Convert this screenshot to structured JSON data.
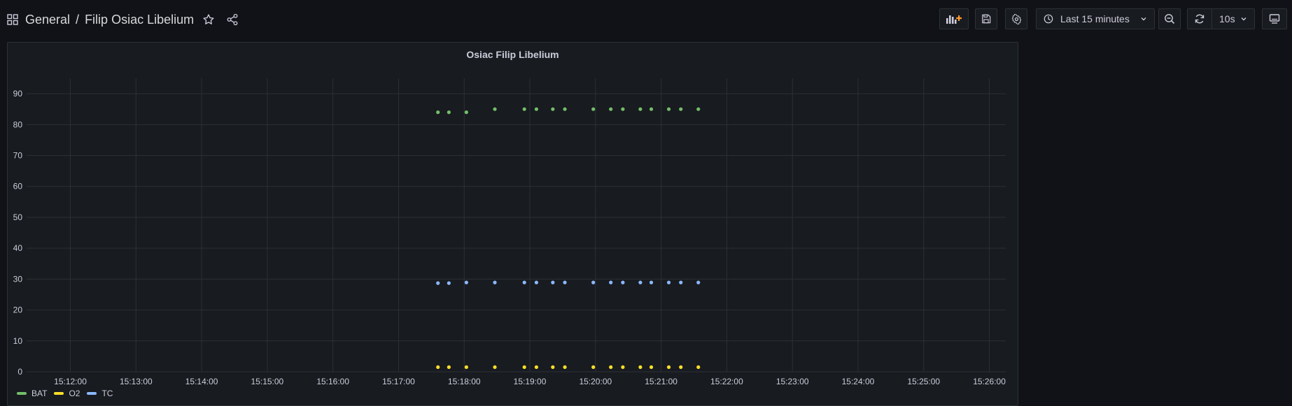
{
  "header": {
    "folder": "General",
    "separator": "/",
    "dashboard_title": "Filip Osiac Libelium"
  },
  "toolbar": {
    "time_range": "Last 15 minutes",
    "refresh_interval": "10s"
  },
  "colors": {
    "BAT": "#73bf69",
    "O2": "#fade2a",
    "TC": "#8ab8ff",
    "accent": "#ff9830"
  },
  "panel": {
    "title": "Osiac Filip Libelium"
  },
  "chart_data": {
    "type": "scatter",
    "title": "Osiac Filip Libelium",
    "xlabel": "",
    "ylabel": "",
    "ylim": [
      0,
      95
    ],
    "yticks": [
      "0",
      "10",
      "20",
      "30",
      "40",
      "50",
      "60",
      "70",
      "80",
      "90"
    ],
    "xlim": [
      "15:11:20",
      "15:26:15"
    ],
    "xticks": [
      "15:12:00",
      "15:13:00",
      "15:14:00",
      "15:15:00",
      "15:16:00",
      "15:17:00",
      "15:18:00",
      "15:19:00",
      "15:20:00",
      "15:21:00",
      "15:22:00",
      "15:23:00",
      "15:24:00",
      "15:25:00",
      "15:26:00"
    ],
    "grid": true,
    "legend_position": "bottom-left",
    "x": [
      "15:17:36",
      "15:17:46",
      "15:18:02",
      "15:18:28",
      "15:18:55",
      "15:19:06",
      "15:19:21",
      "15:19:32",
      "15:19:58",
      "15:20:14",
      "15:20:25",
      "15:20:41",
      "15:20:51",
      "15:21:07",
      "15:21:18",
      "15:21:34"
    ],
    "series": [
      {
        "name": "BAT",
        "values": [
          84,
          84,
          84,
          85,
          85,
          85,
          85,
          85,
          85,
          85,
          85,
          85,
          85,
          85,
          85,
          85
        ]
      },
      {
        "name": "O2",
        "values": [
          1.5,
          1.5,
          1.5,
          1.5,
          1.5,
          1.5,
          1.5,
          1.5,
          1.5,
          1.5,
          1.5,
          1.5,
          1.5,
          1.5,
          1.5,
          1.5
        ]
      },
      {
        "name": "TC",
        "values": [
          28.7,
          28.7,
          28.9,
          28.9,
          28.9,
          28.9,
          28.9,
          28.9,
          28.9,
          28.9,
          28.9,
          28.9,
          28.9,
          28.9,
          28.9,
          28.9
        ]
      }
    ]
  }
}
